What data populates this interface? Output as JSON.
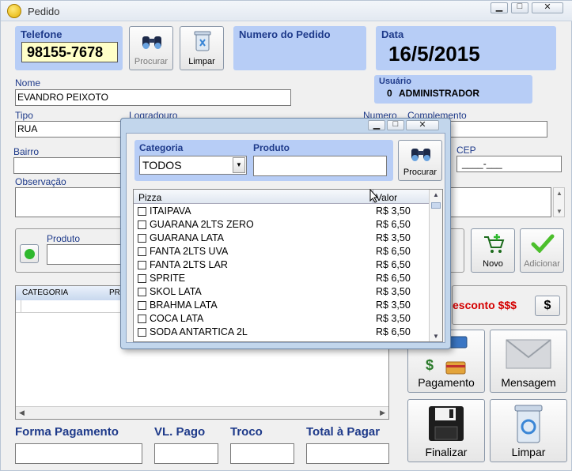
{
  "window": {
    "title": "Pedido",
    "min_label": "▭",
    "max_label": "□",
    "close_label": "✕"
  },
  "telefone": {
    "label": "Telefone",
    "value": "98155-7678"
  },
  "buttons": {
    "procurar": "Procurar",
    "limpar": "Limpar"
  },
  "numero_pedido": {
    "label": "Numero do Pedido",
    "value": ""
  },
  "data": {
    "label": "Data",
    "value": "16/5/2015"
  },
  "usuario": {
    "label": "Usuário",
    "id": "0",
    "name": "ADMINISTRADOR"
  },
  "nome": {
    "label": "Nome",
    "value": "EVANDRO PEIXOTO"
  },
  "tipo": {
    "label": "Tipo",
    "value": "RUA"
  },
  "logradouro": {
    "label": "Logradouro",
    "value": ""
  },
  "numero": {
    "label": "Numero",
    "value": ""
  },
  "complemento": {
    "label": "Complemento",
    "value": ""
  },
  "bairro": {
    "label": "Bairro",
    "value": ""
  },
  "cep": {
    "label": "CEP",
    "value": "____-___"
  },
  "observacao": {
    "label": "Observação",
    "value": ""
  },
  "produto": {
    "label": "Produto",
    "value": ""
  },
  "actions": {
    "novo": "Novo",
    "adicionar": "Adicionar"
  },
  "desconto": {
    "label": "esconto $$$",
    "button": "$"
  },
  "table": {
    "headers": [
      "CATEGORIA",
      "PR"
    ]
  },
  "side_buttons": {
    "pagamento": "Pagamento",
    "mensagem": "Mensagem",
    "finalizar": "Finalizar",
    "limpar": "Limpar"
  },
  "bottom": {
    "forma_pagamento": "Forma Pagamento",
    "vl_pago": "VL. Pago",
    "troco": "Troco",
    "total_pagar": "Total à Pagar"
  },
  "modal": {
    "categoria_label": "Categoria",
    "categoria_value": "TODOS",
    "produto_label": "Produto",
    "produto_value": "",
    "procurar": "Procurar",
    "list_headers": [
      "Pizza",
      "Valor"
    ],
    "items": [
      {
        "name": "ITAIPAVA",
        "price": "R$ 3,50"
      },
      {
        "name": "GUARANA 2LTS ZERO",
        "price": "R$ 6,50"
      },
      {
        "name": "GUARANA LATA",
        "price": "R$ 3,50"
      },
      {
        "name": "FANTA 2LTS UVA",
        "price": "R$ 6,50"
      },
      {
        "name": "FANTA 2LTS LAR",
        "price": "R$ 6,50"
      },
      {
        "name": "SPRITE",
        "price": "R$ 6,50"
      },
      {
        "name": "SKOL LATA",
        "price": "R$ 3,50"
      },
      {
        "name": "BRAHMA LATA",
        "price": "R$ 3,50"
      },
      {
        "name": "COCA LATA",
        "price": "R$ 3,50"
      },
      {
        "name": "SODA ANTARTICA 2L",
        "price": "R$ 6,50"
      }
    ]
  },
  "colors": {
    "panel": "#b7cdf6",
    "label_blue": "#1e3a8a",
    "desconto_red": "#d40000",
    "phone_bg": "#ffffc8"
  }
}
